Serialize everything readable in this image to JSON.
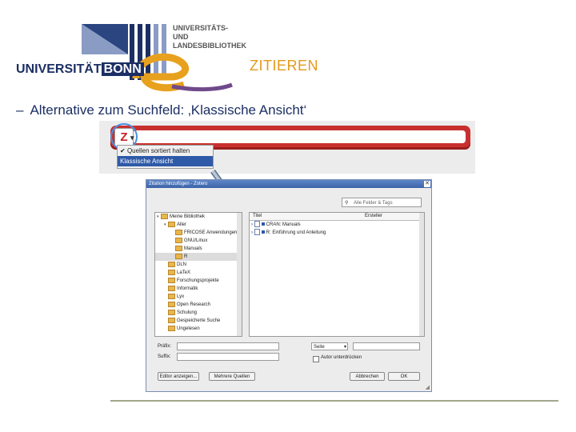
{
  "header": {
    "university_name": "UNIVERSITÄT",
    "university_city": "BONN",
    "library_line1": "UNIVERSITÄTS-",
    "library_line2": "UND LANDESBIBLIOTHEK",
    "slide_title": "ZITIEREN"
  },
  "bullet": {
    "dash": "–",
    "text": "Alternative zum Suchfeld: ‚Klassische Ansicht‘"
  },
  "toolbar": {
    "zotero_letter": "Z",
    "caret": "▾",
    "menu_items": [
      "Quellen sortiert halten",
      "Klassische Ansicht"
    ],
    "menu_check": "✔"
  },
  "dialog": {
    "title": "Zitation hinzufügen - Zotero",
    "close": "✕",
    "search_placeholder": "Alle Felder & Tags",
    "search_icon": "magnifier-icon",
    "tree": [
      {
        "label": "Meine Bibliothek",
        "indent": 0,
        "toggle": "▾"
      },
      {
        "label": "Aller",
        "indent": 1,
        "toggle": "▾"
      },
      {
        "label": "FRICOSE Anwendungen",
        "indent": 2,
        "toggle": ""
      },
      {
        "label": "GNU/Linux",
        "indent": 2,
        "toggle": ""
      },
      {
        "label": "Manuals",
        "indent": 2,
        "toggle": ""
      },
      {
        "label": "R",
        "indent": 2,
        "toggle": "",
        "selected": true
      },
      {
        "label": "DLN",
        "indent": 1,
        "toggle": ""
      },
      {
        "label": "LaTeX",
        "indent": 1,
        "toggle": ""
      },
      {
        "label": "Forschungsprojekte",
        "indent": 1,
        "toggle": ""
      },
      {
        "label": "Informatik",
        "indent": 1,
        "toggle": ""
      },
      {
        "label": "Lyx",
        "indent": 1,
        "toggle": ""
      },
      {
        "label": "Open Research",
        "indent": 1,
        "toggle": ""
      },
      {
        "label": "Schulung",
        "indent": 1,
        "toggle": ""
      },
      {
        "label": "Gespeicherte Suche",
        "indent": 1,
        "toggle": ""
      },
      {
        "label": "Ungelesen",
        "indent": 1,
        "toggle": ""
      }
    ],
    "columns": {
      "title": "Titel",
      "creator": "Ersteller"
    },
    "items": [
      {
        "toggle": "›",
        "title": "CRAN: Manuals"
      },
      {
        "toggle": "›",
        "title": "R: Einführung und Anleitung"
      }
    ],
    "prefix_label": "Präfix:",
    "suffix_label": "Suffix:",
    "locator_select": "Seite",
    "select_caret": "▾",
    "omit_author_label": "Autor unterdrücken",
    "buttons": {
      "multiple_sources": "Mehrere Quellen",
      "show_editor": "Editor anzeigen...",
      "cancel": "Abbrechen",
      "ok": "OK"
    }
  }
}
